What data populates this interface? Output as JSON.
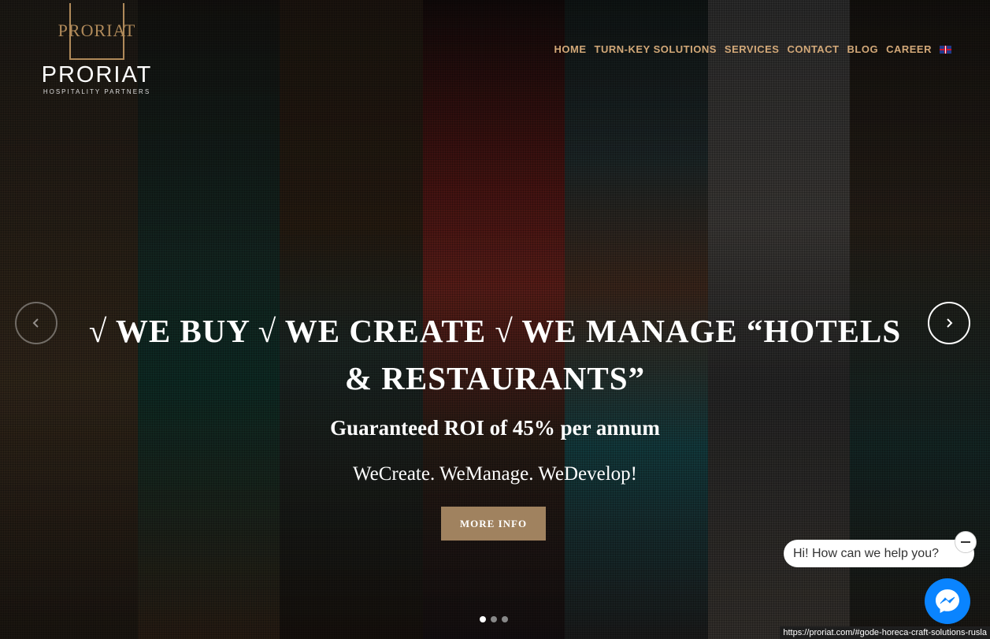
{
  "logo": {
    "mark": "PRORIAT",
    "name": "PRORIAT",
    "subtitle": "HOSPITALITY PARTNERS"
  },
  "nav": {
    "items": [
      {
        "label": "HOME"
      },
      {
        "label": "TURN-KEY SOLUTIONS"
      },
      {
        "label": "SERVICES"
      },
      {
        "label": "CONTACT"
      },
      {
        "label": "BLOG"
      },
      {
        "label": "CAREER"
      }
    ],
    "language_icon": "uk-flag-icon"
  },
  "slider": {
    "headline": "√ WE BUY √ WE CREATE √ WE MANAGE “HOTELS & RESTAURANTS”",
    "subhead": "Guaranteed ROI of 45% per annum",
    "tagline": "WeCreate. WeManage. WeDevelop!",
    "cta_label": "MORE INFO",
    "prev_icon": "chevron-left-icon",
    "next_icon": "chevron-right-icon",
    "active_slide": 1,
    "slide_count": 3
  },
  "chat": {
    "greeting": "Hi! How can we help you?",
    "close_icon": "minus-icon",
    "launcher_icon": "messenger-icon"
  },
  "status_bar": {
    "url": "https://proriat.com/#gode-horeca-craft-solutions-rusla"
  },
  "colors": {
    "accent": "#d2a878",
    "cta": "#a0825f",
    "messenger": "#0a84ff"
  }
}
